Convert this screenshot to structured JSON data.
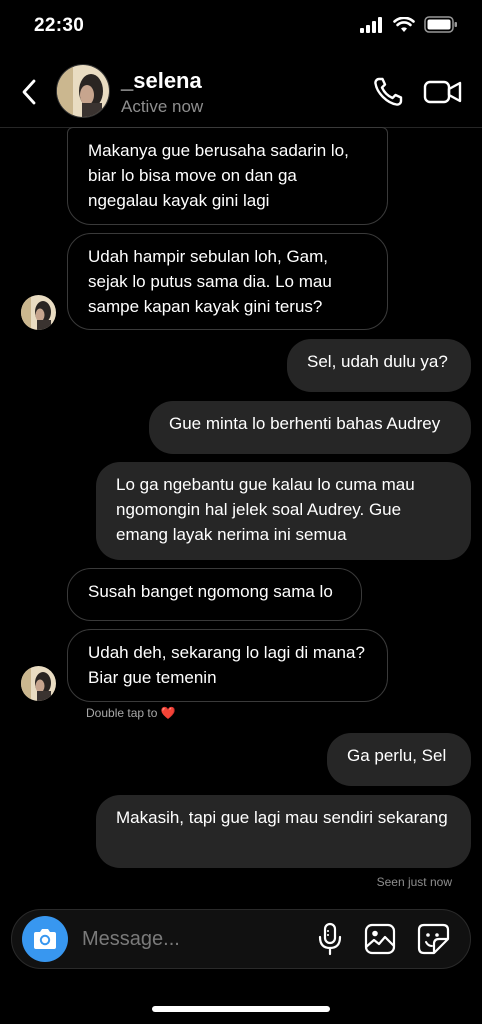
{
  "status_bar": {
    "time": "22:30"
  },
  "header": {
    "name": "_selena",
    "status": "Active now"
  },
  "messages": [
    {
      "text": "Makanya gue berusaha sadarin lo, biar lo bisa move on dan ga ngegalau kayak gini lagi"
    },
    {
      "text": "Udah hampir sebulan loh, Gam, sejak lo putus sama dia. Lo mau sampe kapan kayak gini terus?"
    },
    {
      "text": "Sel, udah dulu ya?"
    },
    {
      "text": "Gue minta lo berhenti bahas Audrey"
    },
    {
      "text": "Lo ga ngebantu gue kalau lo cuma mau ngomongin hal jelek soal Audrey. Gue emang layak nerima ini semua"
    },
    {
      "text": "Susah banget ngomong sama lo"
    },
    {
      "text": "Udah deh, sekarang lo lagi di mana? Biar gue temenin"
    },
    {
      "text": "Ga perlu, Sel"
    },
    {
      "text": "Makasih, tapi gue lagi mau sendiri sekarang"
    }
  ],
  "hint": {
    "text": "Double tap to ❤️"
  },
  "seen": "Seen just now",
  "composer": {
    "placeholder": "Message..."
  },
  "colors": {
    "background": "#000000",
    "outgoing_bubble": "#262626",
    "accent": "#3897f0"
  },
  "icons": [
    "back-icon",
    "phone-icon",
    "video-camera-icon",
    "camera-icon",
    "microphone-icon",
    "gallery-icon",
    "sticker-icon"
  ]
}
